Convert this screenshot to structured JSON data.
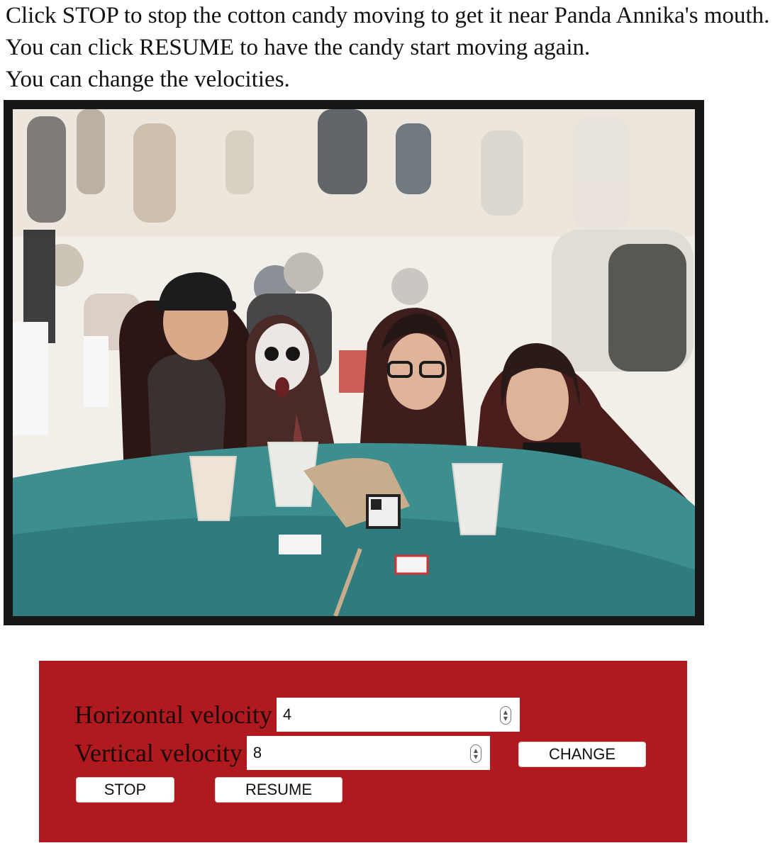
{
  "instructions": {
    "line1": "Click STOP to stop the cotton candy moving to get it near Panda Annika's mouth.",
    "line2": "You can click RESUME to have the candy start moving again.",
    "line3": "You can change the velocities."
  },
  "canvas": {
    "frame_color": "#161616",
    "content": "photo"
  },
  "controls": {
    "panel_color": "#b01a1e",
    "horizontal_label": "Horizontal velocity",
    "horizontal_value": "4",
    "vertical_label": "Vertical velocity",
    "vertical_value": "8",
    "change_label": "CHANGE",
    "stop_label": "STOP",
    "resume_label": "RESUME"
  }
}
